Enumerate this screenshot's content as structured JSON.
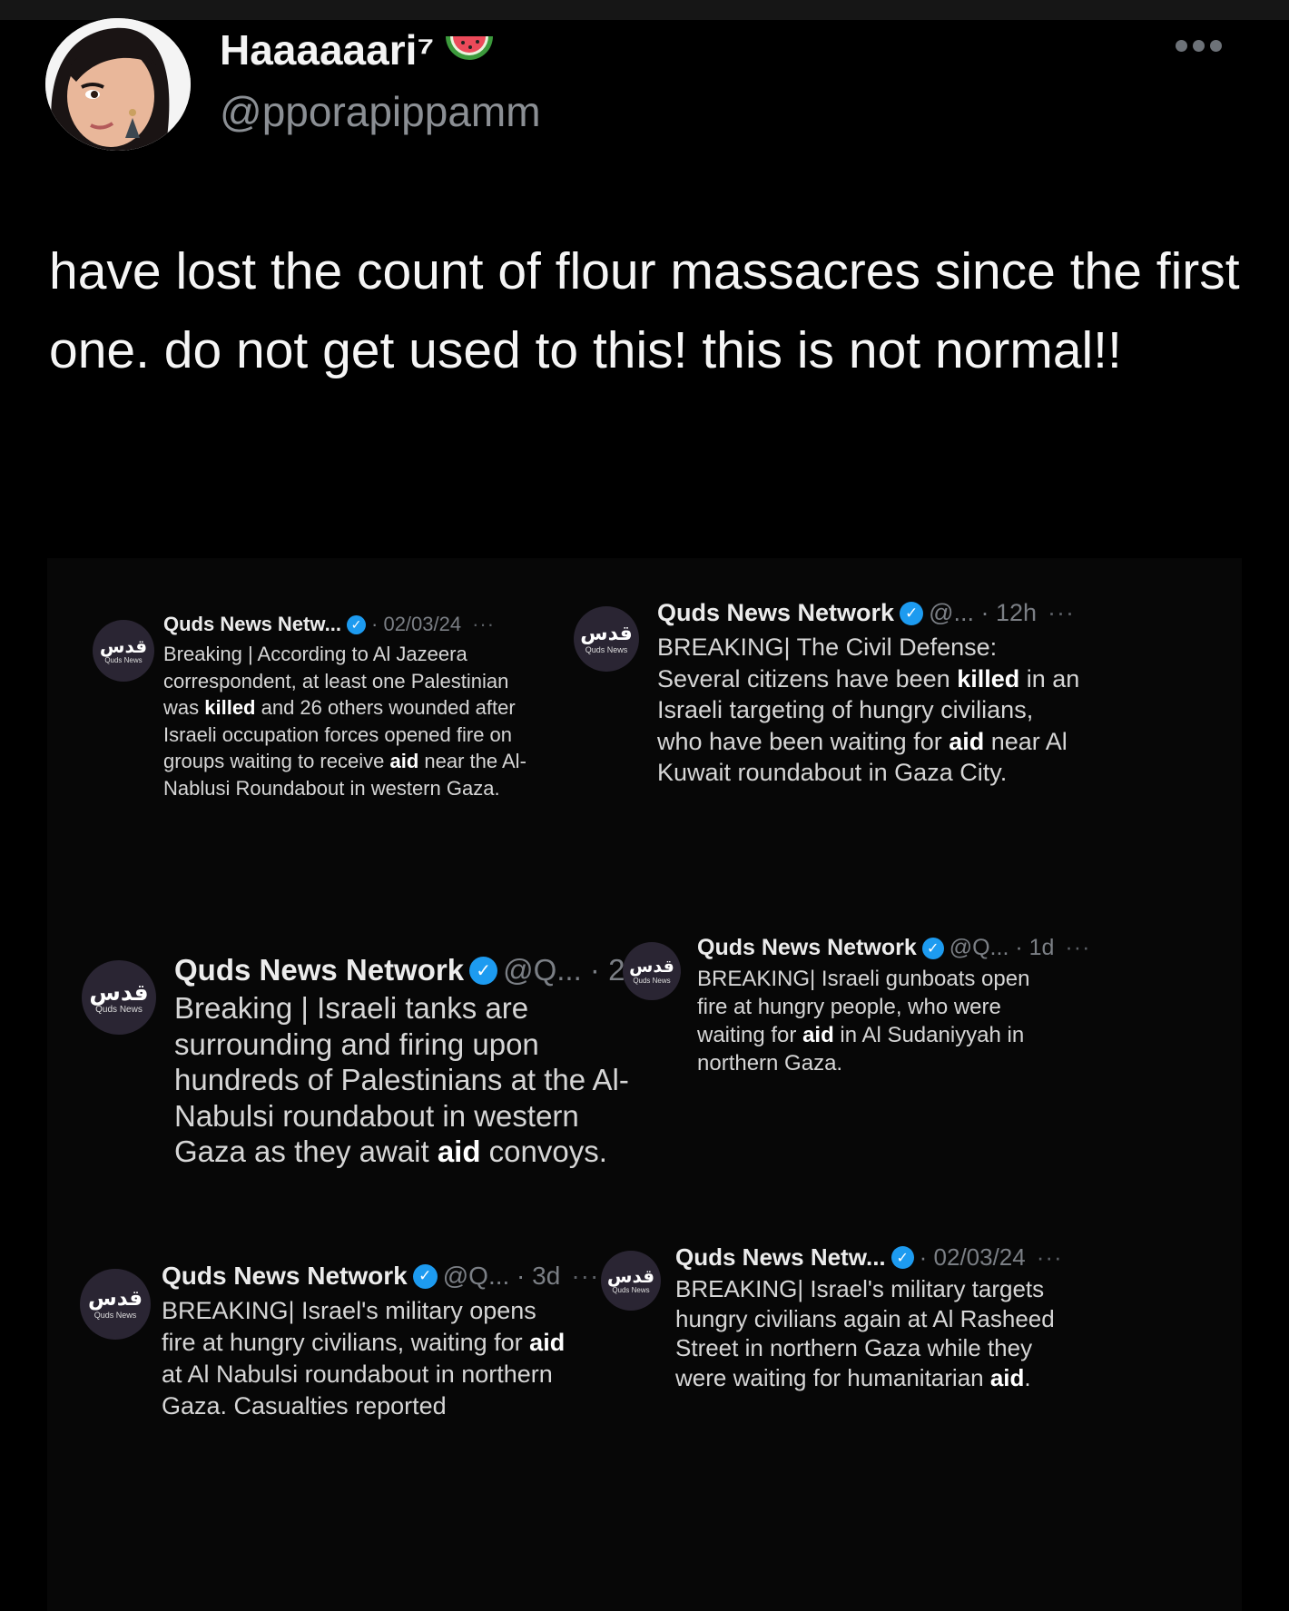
{
  "author": {
    "display_name": "Haaaaaari⁷",
    "handle": "@pporapippamm"
  },
  "post": {
    "text": "have lost the count of flour massacres since the first one. do not get used to this! this is not normal!!"
  },
  "quoted_source": {
    "logo_arabic": "قدس",
    "logo_english": "Quds News"
  },
  "screenshots": [
    {
      "name": "Quds News Netw...",
      "meta": "· 02/03/24",
      "segments": [
        {
          "t": "Breaking | According to Al Jazeera correspondent, at least one Palestinian was "
        },
        {
          "t": "killed",
          "b": true
        },
        {
          "t": " and 26 others wounded after Israeli occupation forces opened fire on groups waiting to receive "
        },
        {
          "t": "aid",
          "b": true
        },
        {
          "t": " near the Al-Nablusi Roundabout in western Gaza."
        }
      ]
    },
    {
      "name": "Quds News Network",
      "meta": "@... · 12h",
      "segments": [
        {
          "t": "BREAKING| The Civil Defense: Several citizens have been "
        },
        {
          "t": "killed",
          "b": true
        },
        {
          "t": " in an Israeli targeting of hungry civilians, who have been waiting for "
        },
        {
          "t": "aid",
          "b": true
        },
        {
          "t": " near Al Kuwait roundabout in Gaza City."
        }
      ]
    },
    {
      "name": "Quds News Network",
      "meta": "@Q... · 2d",
      "segments": [
        {
          "t": "Breaking | Israeli tanks are surrounding and firing upon hundreds of Palestinians at the Al-Nabulsi roundabout in western Gaza as they await "
        },
        {
          "t": "aid",
          "b": true
        },
        {
          "t": " convoys."
        }
      ]
    },
    {
      "name": "Quds News Network",
      "meta": "@Q... · 1d",
      "segments": [
        {
          "t": "BREAKING| Israeli gunboats open fire at hungry people, who were waiting for "
        },
        {
          "t": "aid",
          "b": true
        },
        {
          "t": " in Al Sudaniyyah in northern Gaza."
        }
      ]
    },
    {
      "name": "Quds News Network",
      "meta": "@Q... · 3d",
      "segments": [
        {
          "t": "BREAKING| Israel's military opens fire at hungry civilians, waiting for "
        },
        {
          "t": "aid",
          "b": true
        },
        {
          "t": " at Al Nabulsi roundabout in northern Gaza. Casualties reported"
        }
      ]
    },
    {
      "name": "Quds News Netw...",
      "meta": "· 02/03/24",
      "segments": [
        {
          "t": "BREAKING| Israel's military targets hungry civilians again at Al Rasheed Street in northern Gaza while they were waiting for humanitarian "
        },
        {
          "t": "aid",
          "b": true
        },
        {
          "t": "."
        }
      ]
    }
  ]
}
